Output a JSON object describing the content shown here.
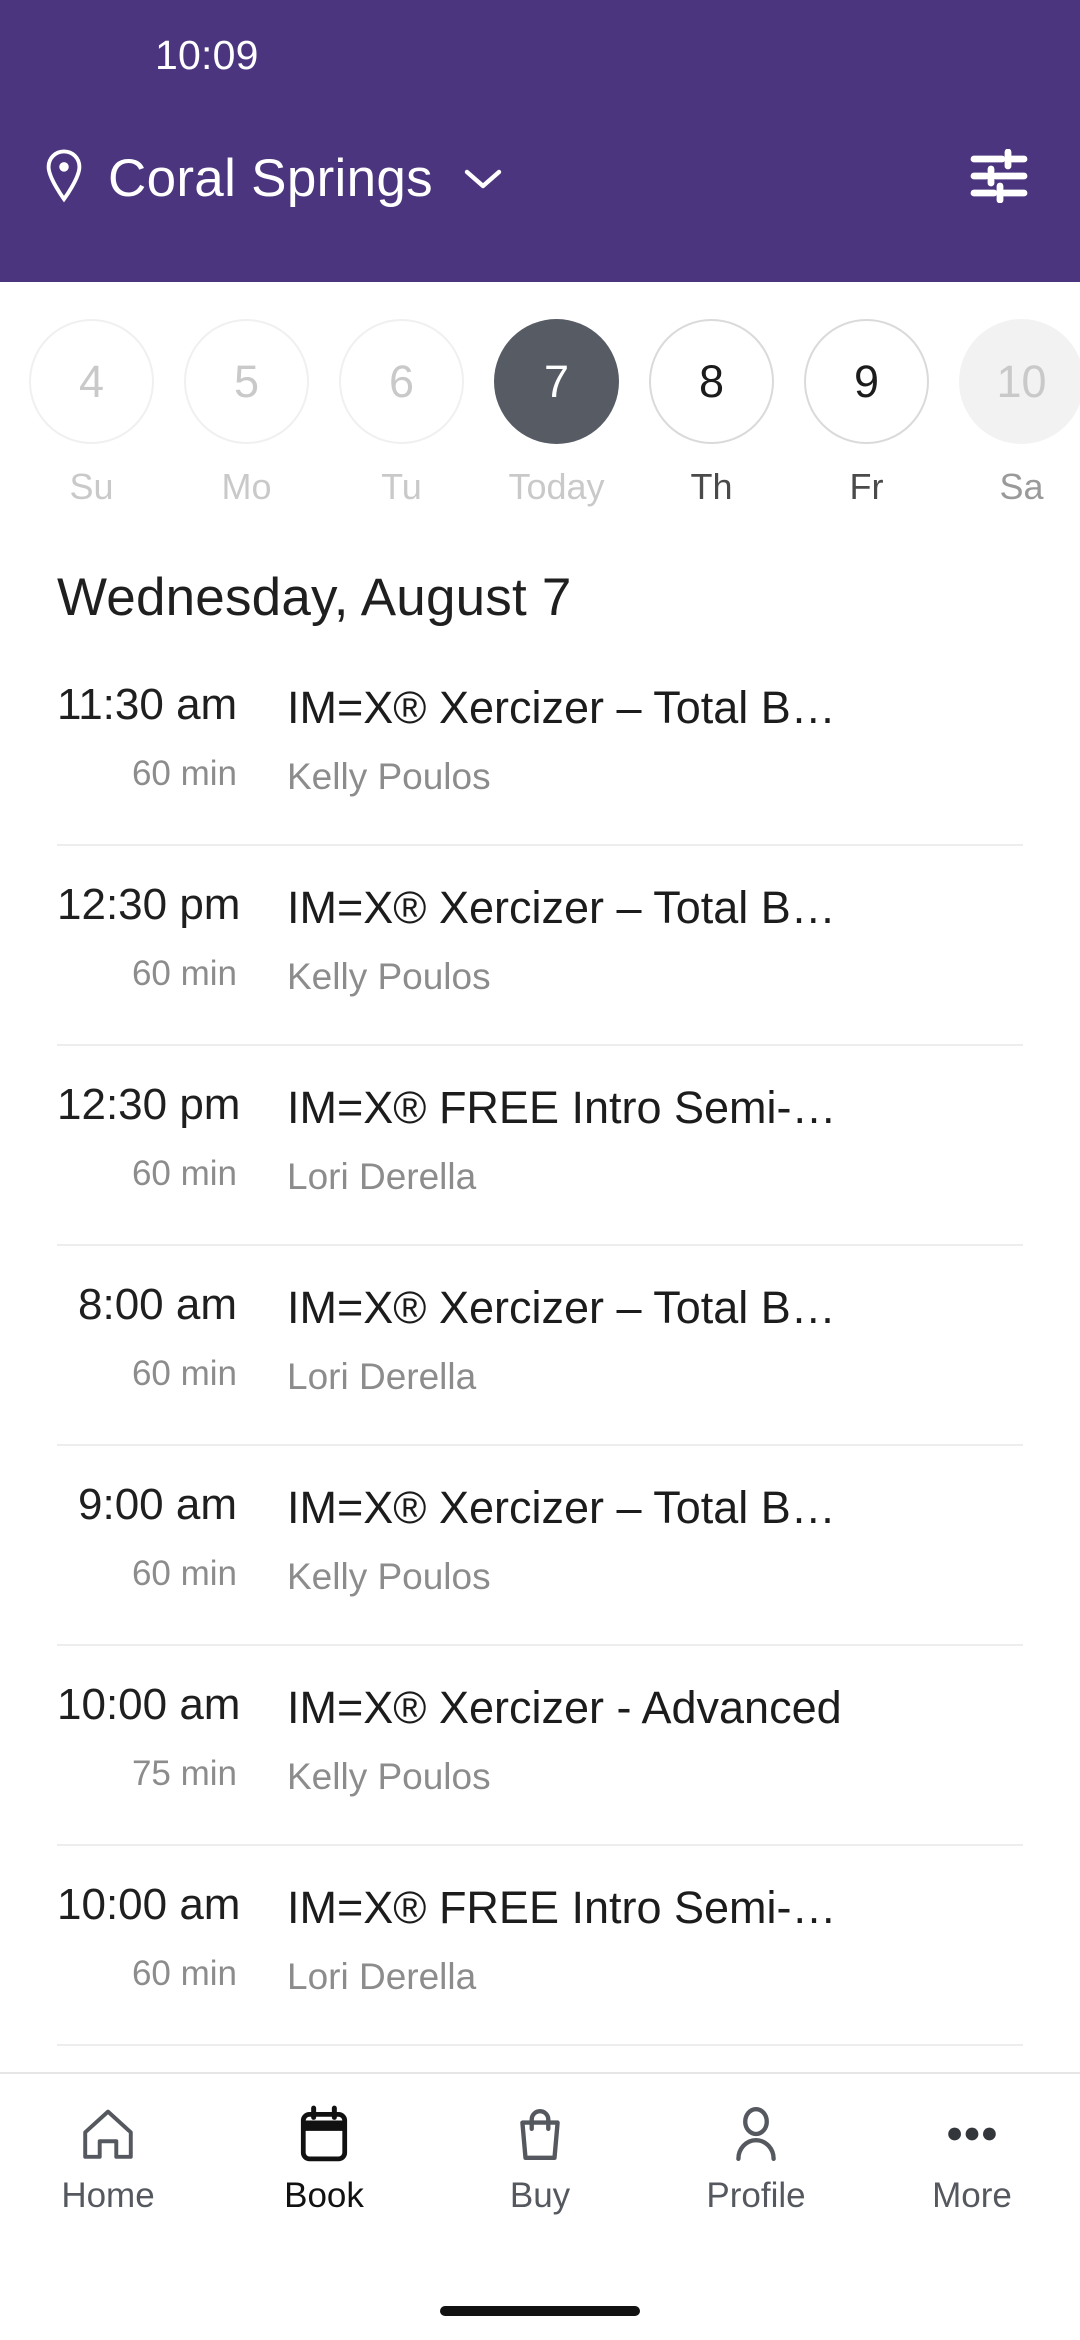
{
  "status_bar": {
    "time": "10:09"
  },
  "header": {
    "location_name": "Coral Springs",
    "pin_icon": "location-pin-icon",
    "chevron_icon": "chevron-down-icon",
    "filter_icon": "filter-sliders-icon",
    "background_color": "#4B357E"
  },
  "date_strip": {
    "days": [
      {
        "num": "4",
        "label": "Su",
        "state": "past"
      },
      {
        "num": "5",
        "label": "Mo",
        "state": "past"
      },
      {
        "num": "6",
        "label": "Tu",
        "state": "past"
      },
      {
        "num": "7",
        "label": "Today",
        "state": "today"
      },
      {
        "num": "8",
        "label": "Th",
        "state": "future"
      },
      {
        "num": "9",
        "label": "Fr",
        "state": "future"
      },
      {
        "num": "10",
        "label": "Sa",
        "state": "edge"
      }
    ],
    "selected_color": "#565B64"
  },
  "day_title": "Wednesday, August 7",
  "classes": [
    {
      "time": "11:30 am",
      "duration": "60 min",
      "name": "IM=X® Xercizer – Total B…",
      "instructor": "Kelly Poulos"
    },
    {
      "time": "12:30 pm",
      "duration": "60 min",
      "name": "IM=X® Xercizer – Total B…",
      "instructor": "Kelly Poulos"
    },
    {
      "time": "12:30 pm",
      "duration": "60 min",
      "name": "IM=X® FREE Intro Semi-…",
      "instructor": "Lori Derella"
    },
    {
      "time": "8:00 am",
      "duration": "60 min",
      "name": "IM=X® Xercizer – Total B…",
      "instructor": "Lori Derella"
    },
    {
      "time": "9:00 am",
      "duration": "60 min",
      "name": "IM=X® Xercizer – Total B…",
      "instructor": "Kelly Poulos"
    },
    {
      "time": "10:00 am",
      "duration": "75 min",
      "name": "IM=X® Xercizer - Advanced",
      "instructor": "Kelly Poulos"
    },
    {
      "time": "10:00 am",
      "duration": "60 min",
      "name": "IM=X® FREE Intro Semi-…",
      "instructor": "Lori Derella"
    }
  ],
  "bottom_nav": {
    "items": [
      {
        "label": "Home",
        "icon": "home-icon",
        "active": false
      },
      {
        "label": "Book",
        "icon": "calendar-icon",
        "active": true
      },
      {
        "label": "Buy",
        "icon": "shopping-bag-icon",
        "active": false
      },
      {
        "label": "Profile",
        "icon": "person-icon",
        "active": false
      },
      {
        "label": "More",
        "icon": "ellipsis-icon",
        "active": false
      }
    ]
  }
}
